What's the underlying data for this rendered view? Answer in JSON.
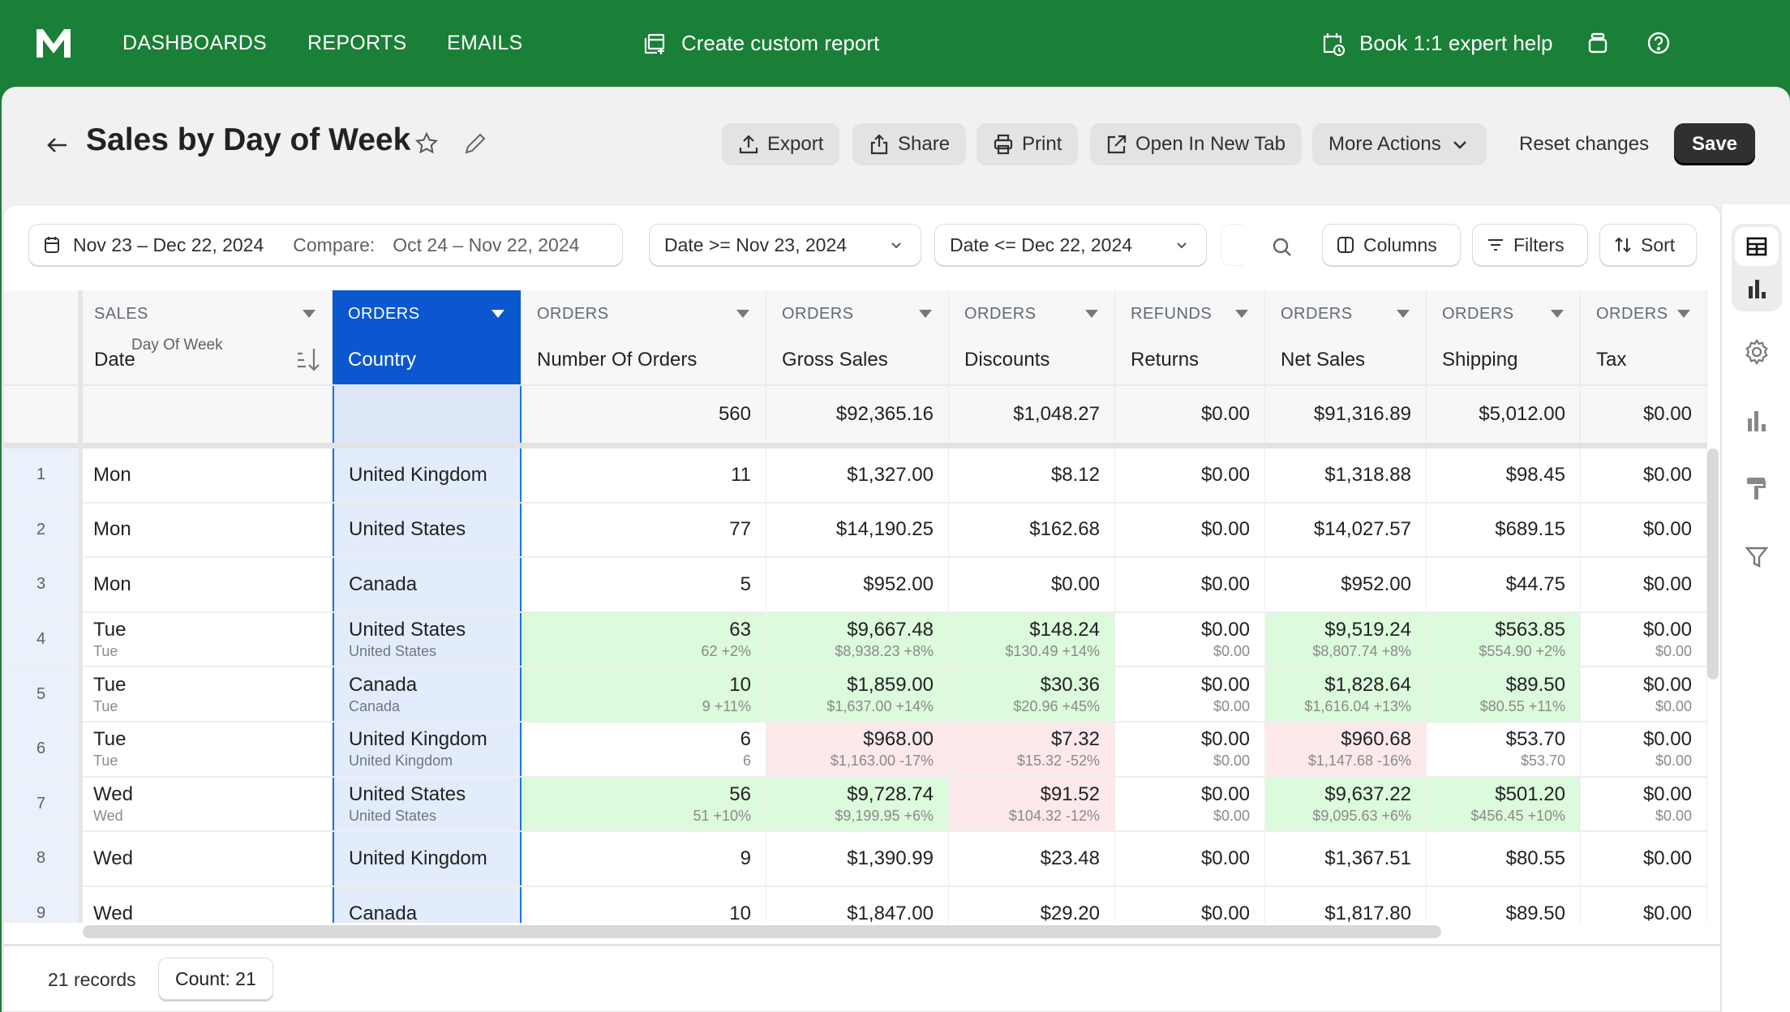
{
  "topbar": {
    "logo": "M",
    "nav": [
      "DASHBOARDS",
      "REPORTS",
      "EMAILS"
    ],
    "create_report": "Create custom report",
    "expert_help": "Book 1:1 expert help",
    "colors": {
      "bg": "#1a7f37"
    }
  },
  "header": {
    "title": "Sales by Day of Week",
    "buttons": {
      "export": "Export",
      "share": "Share",
      "print": "Print",
      "open_new_tab": "Open In New Tab",
      "more_actions": "More Actions",
      "reset": "Reset changes",
      "save": "Save"
    }
  },
  "filters": {
    "date_range": "Nov 23 – Dec 22, 2024",
    "compare_label": "Compare:",
    "compare_range": "Oct 24 – Nov 22, 2024",
    "date_from": "Date >= Nov 23, 2024",
    "date_to": "Date <= Dec 22, 2024",
    "columns": "Columns",
    "filters": "Filters",
    "sort": "Sort"
  },
  "table": {
    "columns": [
      {
        "group": "SALES",
        "name": "Date",
        "sub": "Day Of Week"
      },
      {
        "group": "ORDERS",
        "name": "Country",
        "selected": true
      },
      {
        "group": "ORDERS",
        "name": "Number Of Orders"
      },
      {
        "group": "ORDERS",
        "name": "Gross Sales"
      },
      {
        "group": "ORDERS",
        "name": "Discounts"
      },
      {
        "group": "REFUNDS",
        "name": "Returns"
      },
      {
        "group": "ORDERS",
        "name": "Net Sales"
      },
      {
        "group": "ORDERS",
        "name": "Shipping"
      },
      {
        "group": "ORDERS",
        "name": "Tax"
      }
    ],
    "totals": [
      "",
      "",
      "560",
      "$92,365.16",
      "$1,048.27",
      "$0.00",
      "$91,316.89",
      "$5,012.00",
      "$0.00"
    ],
    "rows": [
      {
        "n": "1",
        "cells": [
          {
            "v": "Mon"
          },
          {
            "v": "United Kingdom"
          },
          {
            "v": "11"
          },
          {
            "v": "$1,327.00"
          },
          {
            "v": "$8.12"
          },
          {
            "v": "$0.00"
          },
          {
            "v": "$1,318.88"
          },
          {
            "v": "$98.45"
          },
          {
            "v": "$0.00"
          }
        ]
      },
      {
        "n": "2",
        "cells": [
          {
            "v": "Mon"
          },
          {
            "v": "United States"
          },
          {
            "v": "77"
          },
          {
            "v": "$14,190.25"
          },
          {
            "v": "$162.68"
          },
          {
            "v": "$0.00"
          },
          {
            "v": "$14,027.57"
          },
          {
            "v": "$689.15"
          },
          {
            "v": "$0.00"
          }
        ]
      },
      {
        "n": "3",
        "cells": [
          {
            "v": "Mon"
          },
          {
            "v": "Canada"
          },
          {
            "v": "5"
          },
          {
            "v": "$952.00"
          },
          {
            "v": "$0.00"
          },
          {
            "v": "$0.00"
          },
          {
            "v": "$952.00"
          },
          {
            "v": "$44.75"
          },
          {
            "v": "$0.00"
          }
        ]
      },
      {
        "n": "4",
        "cells": [
          {
            "v": "Tue",
            "s": "Tue"
          },
          {
            "v": "United States",
            "s": "United States"
          },
          {
            "v": "63",
            "s": "62 +2%",
            "t": "up"
          },
          {
            "v": "$9,667.48",
            "s": "$8,938.23 +8%",
            "t": "up"
          },
          {
            "v": "$148.24",
            "s": "$130.49 +14%",
            "t": "up"
          },
          {
            "v": "$0.00",
            "s": "$0.00"
          },
          {
            "v": "$9,519.24",
            "s": "$8,807.74 +8%",
            "t": "up"
          },
          {
            "v": "$563.85",
            "s": "$554.90 +2%",
            "t": "up"
          },
          {
            "v": "$0.00",
            "s": "$0.00"
          }
        ]
      },
      {
        "n": "5",
        "cells": [
          {
            "v": "Tue",
            "s": "Tue"
          },
          {
            "v": "Canada",
            "s": "Canada"
          },
          {
            "v": "10",
            "s": "9 +11%",
            "t": "up"
          },
          {
            "v": "$1,859.00",
            "s": "$1,637.00 +14%",
            "t": "up"
          },
          {
            "v": "$30.36",
            "s": "$20.96 +45%",
            "t": "up"
          },
          {
            "v": "$0.00",
            "s": "$0.00"
          },
          {
            "v": "$1,828.64",
            "s": "$1,616.04 +13%",
            "t": "up"
          },
          {
            "v": "$89.50",
            "s": "$80.55 +11%",
            "t": "up"
          },
          {
            "v": "$0.00",
            "s": "$0.00"
          }
        ]
      },
      {
        "n": "6",
        "cells": [
          {
            "v": "Tue",
            "s": "Tue"
          },
          {
            "v": "United Kingdom",
            "s": "United Kingdom"
          },
          {
            "v": "6",
            "s": "6"
          },
          {
            "v": "$968.00",
            "s": "$1,163.00 -17%",
            "t": "down"
          },
          {
            "v": "$7.32",
            "s": "$15.32 -52%",
            "t": "down"
          },
          {
            "v": "$0.00",
            "s": "$0.00"
          },
          {
            "v": "$960.68",
            "s": "$1,147.68 -16%",
            "t": "down"
          },
          {
            "v": "$53.70",
            "s": "$53.70"
          },
          {
            "v": "$0.00",
            "s": "$0.00"
          }
        ]
      },
      {
        "n": "7",
        "cells": [
          {
            "v": "Wed",
            "s": "Wed"
          },
          {
            "v": "United States",
            "s": "United States"
          },
          {
            "v": "56",
            "s": "51 +10%",
            "t": "up"
          },
          {
            "v": "$9,728.74",
            "s": "$9,199.95 +6%",
            "t": "up"
          },
          {
            "v": "$91.52",
            "s": "$104.32 -12%",
            "t": "down"
          },
          {
            "v": "$0.00",
            "s": "$0.00"
          },
          {
            "v": "$9,637.22",
            "s": "$9,095.63 +6%",
            "t": "up"
          },
          {
            "v": "$501.20",
            "s": "$456.45 +10%",
            "t": "up"
          },
          {
            "v": "$0.00",
            "s": "$0.00"
          }
        ]
      },
      {
        "n": "8",
        "cells": [
          {
            "v": "Wed"
          },
          {
            "v": "United Kingdom"
          },
          {
            "v": "9"
          },
          {
            "v": "$1,390.99"
          },
          {
            "v": "$23.48"
          },
          {
            "v": "$0.00"
          },
          {
            "v": "$1,367.51"
          },
          {
            "v": "$80.55"
          },
          {
            "v": "$0.00"
          }
        ]
      },
      {
        "n": "9",
        "cells": [
          {
            "v": "Wed"
          },
          {
            "v": "Canada"
          },
          {
            "v": "10"
          },
          {
            "v": "$1,847.00"
          },
          {
            "v": "$29.20"
          },
          {
            "v": "$0.00"
          },
          {
            "v": "$1,817.80"
          },
          {
            "v": "$89.50"
          },
          {
            "v": "$0.00"
          }
        ]
      }
    ]
  },
  "footer": {
    "records": "21 records",
    "count": "Count: 21"
  }
}
